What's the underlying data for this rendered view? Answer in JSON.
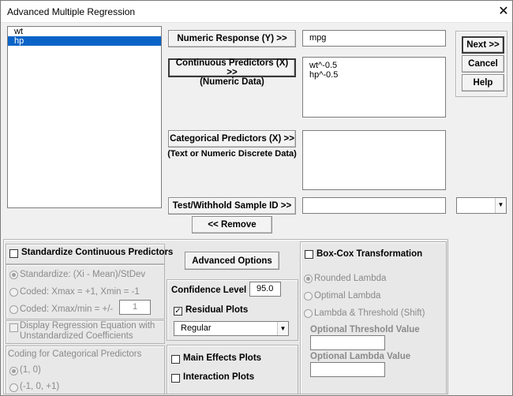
{
  "window": {
    "title": "Advanced Multiple Regression",
    "close_glyph": "✕"
  },
  "variables": [
    "wt",
    "hp"
  ],
  "buttons": {
    "numeric_response": "Numeric Response (Y) >>",
    "continuous_predictors": "Continuous Predictors (X) >>",
    "categorical_predictors": "Categorical Predictors (X) >>",
    "test_withhold": "Test/Withhold Sample ID >>",
    "remove": "<< Remove",
    "next": "Next >>",
    "cancel": "Cancel",
    "help": "Help",
    "advanced_options": "Advanced Options"
  },
  "labels": {
    "numeric_data": "(Numeric Data)",
    "text_numeric_discrete": "(Text or Numeric Discrete Data)"
  },
  "fields": {
    "numeric_response_value": "mpg",
    "continuous_predictors": [
      "wt^-0.5",
      "hp^-0.5"
    ]
  },
  "standardize": {
    "label": "Standardize Continuous Predictors",
    "option1": "Standardize: (Xi - Mean)/StDev",
    "option2": "Coded: Xmax = +1, Xmin = -1",
    "option3": "Coded: Xmax/min = +/-",
    "option3_value": "1"
  },
  "display_equation": {
    "label_line1": "Display Regression Equation with",
    "label_line2": "Unstandardized Coefficients"
  },
  "coding": {
    "label": "Coding for Categorical Predictors",
    "option1": "(1, 0)",
    "option2": "(-1, 0, +1)"
  },
  "confidence": {
    "label": "Confidence Level",
    "value": "95.0"
  },
  "residual": {
    "label": "Residual Plots",
    "checked": true,
    "select_value": "Regular"
  },
  "plots": {
    "main_effects": "Main Effects Plots",
    "interaction": "Interaction Plots"
  },
  "boxcox": {
    "label": "Box-Cox Transformation",
    "option1": "Rounded Lambda",
    "option2": "Optimal Lambda",
    "option3": "Lambda & Threshold (Shift)",
    "threshold_label": "Optional Threshold Value",
    "lambda_label": "Optional Lambda Value"
  }
}
